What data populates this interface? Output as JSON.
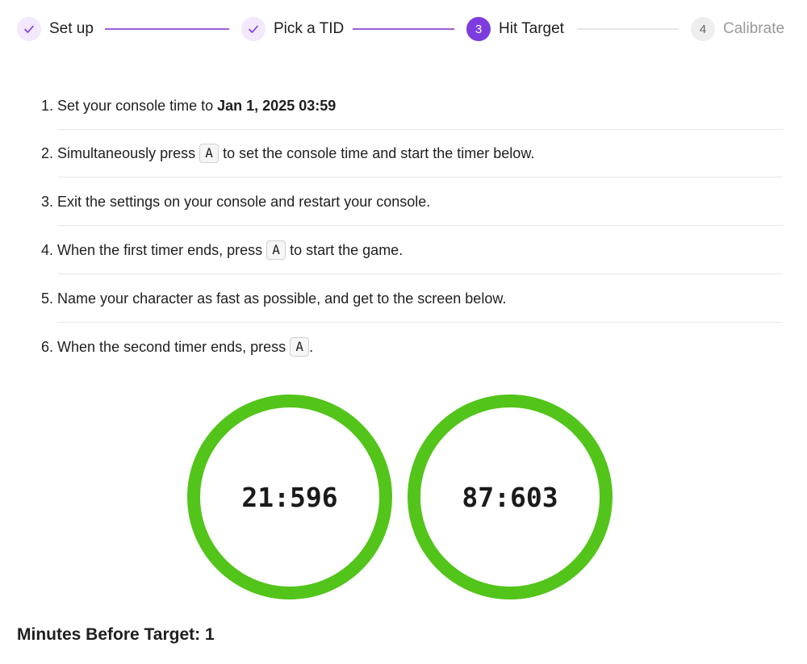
{
  "stepper": {
    "steps": [
      {
        "number": "1",
        "label": "Set up",
        "status": "done",
        "icon": "check-icon"
      },
      {
        "number": "2",
        "label": "Pick a TID",
        "status": "done",
        "icon": "check-icon"
      },
      {
        "number": "3",
        "label": "Hit Target",
        "status": "active"
      },
      {
        "number": "4",
        "label": "Calibrate",
        "status": "pending"
      }
    ]
  },
  "instructions": {
    "items": [
      {
        "num": "1.",
        "before": "Set your console time to ",
        "bold": "Jan 1, 2025 03:59",
        "after": ""
      },
      {
        "num": "2.",
        "before": "Simultaneously press ",
        "key": "A",
        "after": " to set the console time and start the timer below."
      },
      {
        "num": "3.",
        "before": "Exit the settings on your console and restart your console.",
        "after": ""
      },
      {
        "num": "4.",
        "before": "When the first timer ends, press ",
        "key": "A",
        "after": " to start the game."
      },
      {
        "num": "5.",
        "before": "Name your character as fast as possible, and get to the screen below.",
        "after": ""
      },
      {
        "num": "6.",
        "before": "When the second timer ends, press ",
        "key": "A",
        "after": "."
      }
    ]
  },
  "timers": [
    {
      "value": "21:596"
    },
    {
      "value": "87:603"
    }
  ],
  "footer": {
    "minutes_label": "Minutes Before Target: 1"
  },
  "colors": {
    "accent": "#7d3ce0",
    "done_bg": "#f3e8fd",
    "timer_ring": "#52c41a"
  }
}
